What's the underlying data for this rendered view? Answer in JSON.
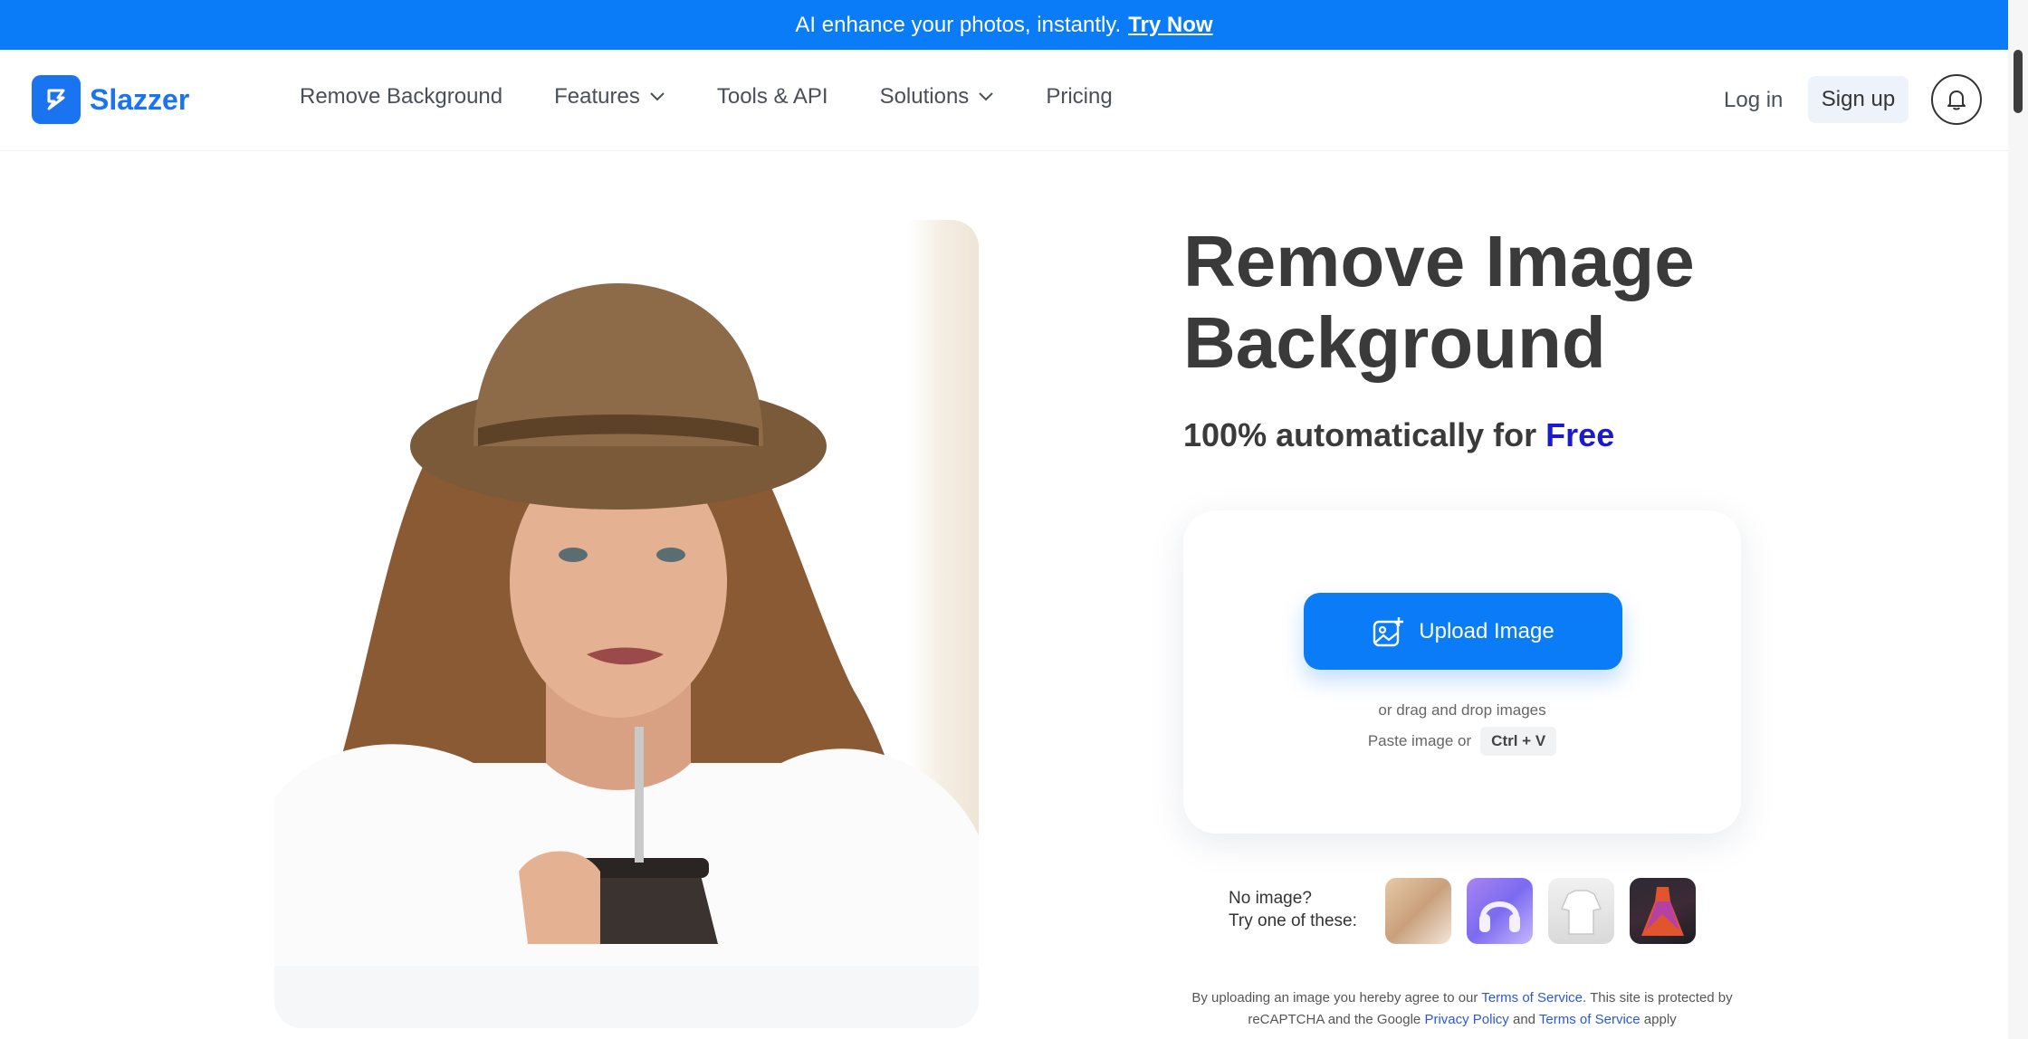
{
  "banner": {
    "text": "AI enhance your photos, instantly.",
    "link": "Try Now"
  },
  "header": {
    "brand": "Slazzer",
    "nav": [
      {
        "label": "Remove Background",
        "has_dropdown": false
      },
      {
        "label": "Features",
        "has_dropdown": true
      },
      {
        "label": "Tools & API",
        "has_dropdown": false
      },
      {
        "label": "Solutions",
        "has_dropdown": true
      },
      {
        "label": "Pricing",
        "has_dropdown": false
      }
    ],
    "login": "Log in",
    "signup": "Sign up"
  },
  "hero": {
    "title": "Remove Image Background",
    "subtitle_prefix": "100% automatically for",
    "subtitle_highlight": "Free"
  },
  "upload": {
    "button_label": "Upload Image",
    "drag_text": "or drag and drop images",
    "paste_text": "Paste image or",
    "shortcut": "Ctrl + V"
  },
  "samples": {
    "label_line1": "No image?",
    "label_line2": "Try one of these:"
  },
  "legal": {
    "part1": "By uploading an image you hereby agree to our",
    "terms1": "Terms of Service",
    "part2": ". This site is protected by reCAPTCHA and the Google",
    "privacy": "Privacy Policy",
    "part3": "and",
    "terms2": "Terms of Service",
    "part4": "apply"
  },
  "colors": {
    "accent": "#0a7cf8",
    "brand": "#1a73f0",
    "highlight": "#1a1ad0"
  }
}
